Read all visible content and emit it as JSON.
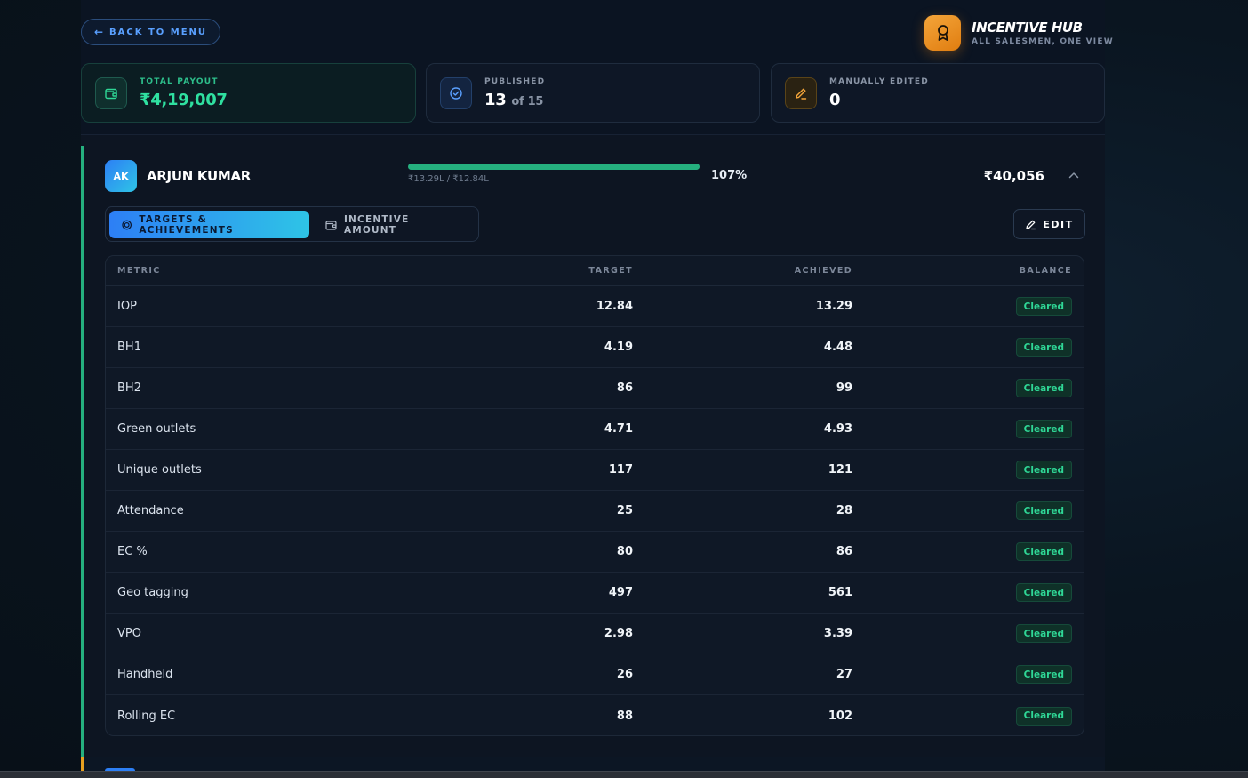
{
  "header": {
    "back_label": "BACK TO MENU",
    "brand_title": "INCENTIVE HUB",
    "brand_subtitle": "ALL SALESMEN, ONE VIEW"
  },
  "stats": {
    "total_payout": {
      "label": "TOTAL PAYOUT",
      "value": "₹4,19,007"
    },
    "published": {
      "label": "PUBLISHED",
      "value": "13",
      "suffix": "of 15"
    },
    "manually_edited": {
      "label": "MANUALLY EDITED",
      "value": "0"
    }
  },
  "salesman": {
    "initials": "AK",
    "name": "ARJUN KUMAR",
    "progress_text": "₹13.29L / ₹12.84L",
    "progress_pct": "107%",
    "progress_fraction": 1.0,
    "amount": "₹40,056"
  },
  "tabs": {
    "targets_label": "TARGETS & ACHIEVEMENTS",
    "incentive_label": "INCENTIVE AMOUNT"
  },
  "edit_label": "EDIT",
  "table": {
    "headers": {
      "metric": "METRIC",
      "target": "TARGET",
      "achieved": "ACHIEVED",
      "balance": "BALANCE"
    },
    "rows": [
      {
        "metric": "IOP",
        "target": "12.84",
        "achieved": "13.29",
        "balance": "Cleared"
      },
      {
        "metric": "BH1",
        "target": "4.19",
        "achieved": "4.48",
        "balance": "Cleared"
      },
      {
        "metric": "BH2",
        "target": "86",
        "achieved": "99",
        "balance": "Cleared"
      },
      {
        "metric": "Green outlets",
        "target": "4.71",
        "achieved": "4.93",
        "balance": "Cleared"
      },
      {
        "metric": "Unique outlets",
        "target": "117",
        "achieved": "121",
        "balance": "Cleared"
      },
      {
        "metric": "Attendance",
        "target": "25",
        "achieved": "28",
        "balance": "Cleared"
      },
      {
        "metric": "EC %",
        "target": "80",
        "achieved": "86",
        "balance": "Cleared"
      },
      {
        "metric": "Geo tagging",
        "target": "497",
        "achieved": "561",
        "balance": "Cleared"
      },
      {
        "metric": "VPO",
        "target": "2.98",
        "achieved": "3.39",
        "balance": "Cleared"
      },
      {
        "metric": "Handheld",
        "target": "26",
        "achieved": "27",
        "balance": "Cleared"
      },
      {
        "metric": "Rolling EC",
        "target": "88",
        "achieved": "102",
        "balance": "Cleared"
      }
    ]
  },
  "colors": {
    "accent_green": "#25b07f",
    "accent_blue": "#2d7ff5",
    "brand_orange": "#f4a53a",
    "cleared_text": "#2fd796"
  }
}
